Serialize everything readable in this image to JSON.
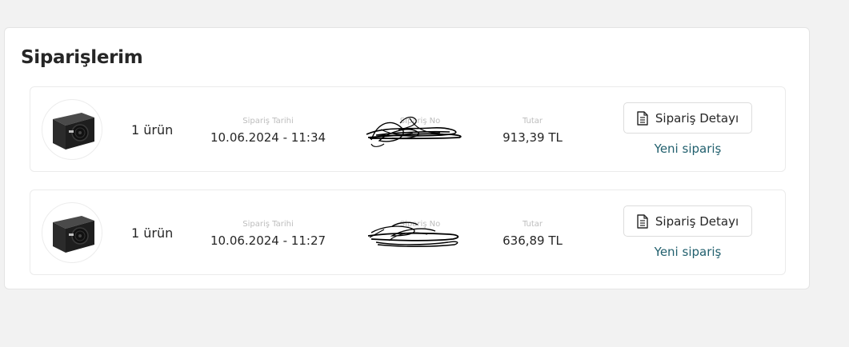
{
  "page": {
    "title": "Siparişlerim"
  },
  "orders": [
    {
      "item_count": "1 ürün",
      "date_label": "Sipariş Tarihi",
      "date_value": "10.06.2024 - 11:34",
      "number_label": "Sipariş No",
      "number_value": "",
      "amount_label": "Tutar",
      "amount_value": "913,39 TL",
      "detail_button": "Sipariş Detayı",
      "reorder_link": "Yeni sipariş",
      "product_image": "power-supply-unit"
    },
    {
      "item_count": "1 ürün",
      "date_label": "Sipariş Tarihi",
      "date_value": "10.06.2024 - 11:27",
      "number_label": "Sipariş No",
      "number_value": "",
      "amount_label": "Tutar",
      "amount_value": "636,89 TL",
      "detail_button": "Sipariş Detayı",
      "reorder_link": "Yeni sipariş",
      "product_image": "power-supply-unit"
    }
  ],
  "icons": {
    "detail": "document-icon",
    "redaction": "scribble-redaction"
  },
  "colors": {
    "link": "#22606e",
    "page_background": "#f2f2f2",
    "card_border": "#ebebeb"
  }
}
